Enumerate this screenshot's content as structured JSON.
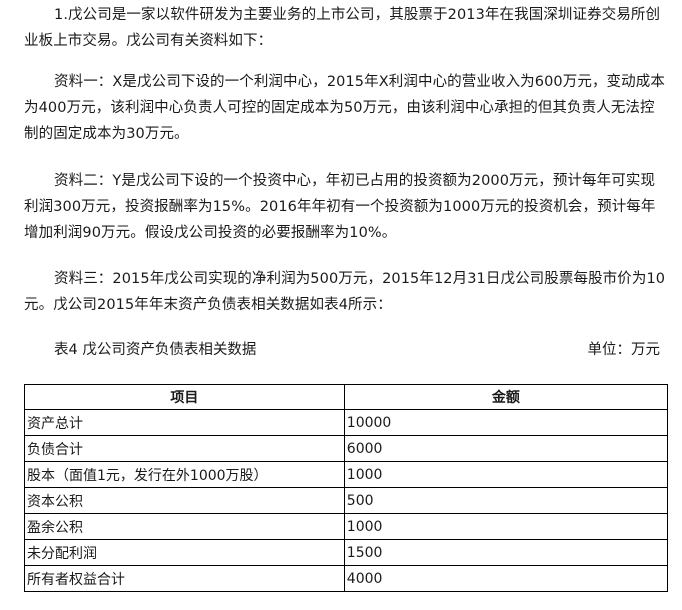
{
  "paragraphs": {
    "intro": "1.戊公司是一家以软件研发为主要业务的上市公司，其股票于2013年在我国深圳证券交易所创业板上市交易。戊公司有关资料如下：",
    "material_1": "资料一：X是戊公司下设的一个利润中心，2015年X利润中心的营业收入为600万元，变动成本为400万元，该利润中心负责人可控的固定成本为50万元，由该利润中心承担的但其负责人无法控制的固定成本为30万元。",
    "material_2": "资料二：Y是戊公司下设的一个投资中心，年初已占用的投资额为2000万元，预计每年可实现利润300万元，投资报酬率为15%。2016年年初有一个投资额为1000万元的投资机会，预计每年增加利润90万元。假设戊公司投资的必要报酬率为10%。",
    "material_3": "资料三：2015年戊公司实现的净利润为500万元，2015年12月31日戊公司股票每股市价为10元。戊公司2015年年末资产负债表相关数据如表4所示："
  },
  "table": {
    "caption": "表4 戊公司资产负债表相关数据",
    "unit": "单位：万元",
    "headers": [
      "项目",
      "金额"
    ],
    "rows": [
      {
        "item": "资产总计",
        "amount": "10000"
      },
      {
        "item": "负债合计",
        "amount": "6000"
      },
      {
        "item": "股本（面值1元，发行在外1000万股）",
        "amount": "1000"
      },
      {
        "item": "资本公积",
        "amount": "500"
      },
      {
        "item": "盈余公积",
        "amount": "1000"
      },
      {
        "item": "未分配利润",
        "amount": "1500"
      },
      {
        "item": "所有者权益合计",
        "amount": "4000"
      }
    ]
  }
}
